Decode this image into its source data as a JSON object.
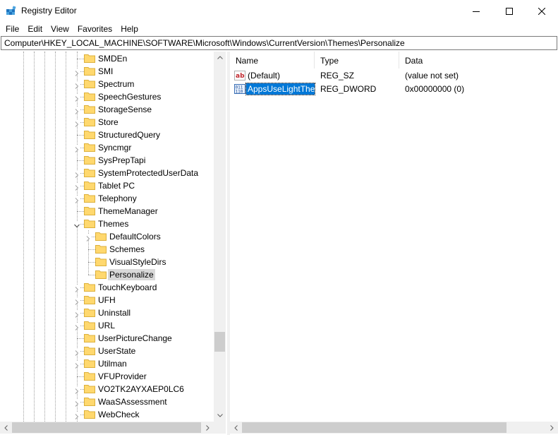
{
  "window": {
    "title": "Registry Editor",
    "icon": "registry-editor-icon"
  },
  "menu": [
    "File",
    "Edit",
    "View",
    "Favorites",
    "Help"
  ],
  "address": "Computer\\HKEY_LOCAL_MACHINE\\SOFTWARE\\Microsoft\\Windows\\CurrentVersion\\Themes\\Personalize",
  "tree": {
    "items": [
      {
        "label": "SMDEn",
        "level": 0,
        "expander": "none"
      },
      {
        "label": "SMI",
        "level": 0,
        "expander": "collapsed"
      },
      {
        "label": "Spectrum",
        "level": 0,
        "expander": "collapsed"
      },
      {
        "label": "SpeechGestures",
        "level": 0,
        "expander": "collapsed"
      },
      {
        "label": "StorageSense",
        "level": 0,
        "expander": "collapsed"
      },
      {
        "label": "Store",
        "level": 0,
        "expander": "collapsed"
      },
      {
        "label": "StructuredQuery",
        "level": 0,
        "expander": "none"
      },
      {
        "label": "Syncmgr",
        "level": 0,
        "expander": "collapsed"
      },
      {
        "label": "SysPrepTapi",
        "level": 0,
        "expander": "none"
      },
      {
        "label": "SystemProtectedUserData",
        "level": 0,
        "expander": "collapsed"
      },
      {
        "label": "Tablet PC",
        "level": 0,
        "expander": "collapsed"
      },
      {
        "label": "Telephony",
        "level": 0,
        "expander": "collapsed"
      },
      {
        "label": "ThemeManager",
        "level": 0,
        "expander": "none"
      },
      {
        "label": "Themes",
        "level": 0,
        "expander": "expanded"
      },
      {
        "label": "DefaultColors",
        "level": 1,
        "expander": "collapsed"
      },
      {
        "label": "Schemes",
        "level": 1,
        "expander": "none"
      },
      {
        "label": "VisualStyleDirs",
        "level": 1,
        "expander": "none"
      },
      {
        "label": "Personalize",
        "level": 1,
        "expander": "none",
        "selected": true
      },
      {
        "label": "TouchKeyboard",
        "level": 0,
        "expander": "collapsed"
      },
      {
        "label": "UFH",
        "level": 0,
        "expander": "collapsed"
      },
      {
        "label": "Uninstall",
        "level": 0,
        "expander": "collapsed"
      },
      {
        "label": "URL",
        "level": 0,
        "expander": "collapsed"
      },
      {
        "label": "UserPictureChange",
        "level": 0,
        "expander": "none"
      },
      {
        "label": "UserState",
        "level": 0,
        "expander": "collapsed"
      },
      {
        "label": "Utilman",
        "level": 0,
        "expander": "collapsed"
      },
      {
        "label": "VFUProvider",
        "level": 0,
        "expander": "none"
      },
      {
        "label": "VO2TK2AYXAEP0LC6",
        "level": 0,
        "expander": "collapsed"
      },
      {
        "label": "WaaSAssessment",
        "level": 0,
        "expander": "collapsed"
      },
      {
        "label": "WebCheck",
        "level": 0,
        "expander": "collapsed"
      }
    ]
  },
  "list": {
    "columns": [
      "Name",
      "Type",
      "Data"
    ],
    "rows": [
      {
        "name": "(Default)",
        "type": "REG_SZ",
        "data": "(value not set)",
        "icon": "string-value-icon"
      },
      {
        "name": "AppsUseLightTheme",
        "type": "REG_DWORD",
        "data": "0x00000000 (0)",
        "icon": "binary-value-icon",
        "selected": true
      }
    ]
  },
  "colors": {
    "folder": "#ffd86e",
    "folder_edge": "#dcb03c",
    "selection": "#0078d7"
  }
}
